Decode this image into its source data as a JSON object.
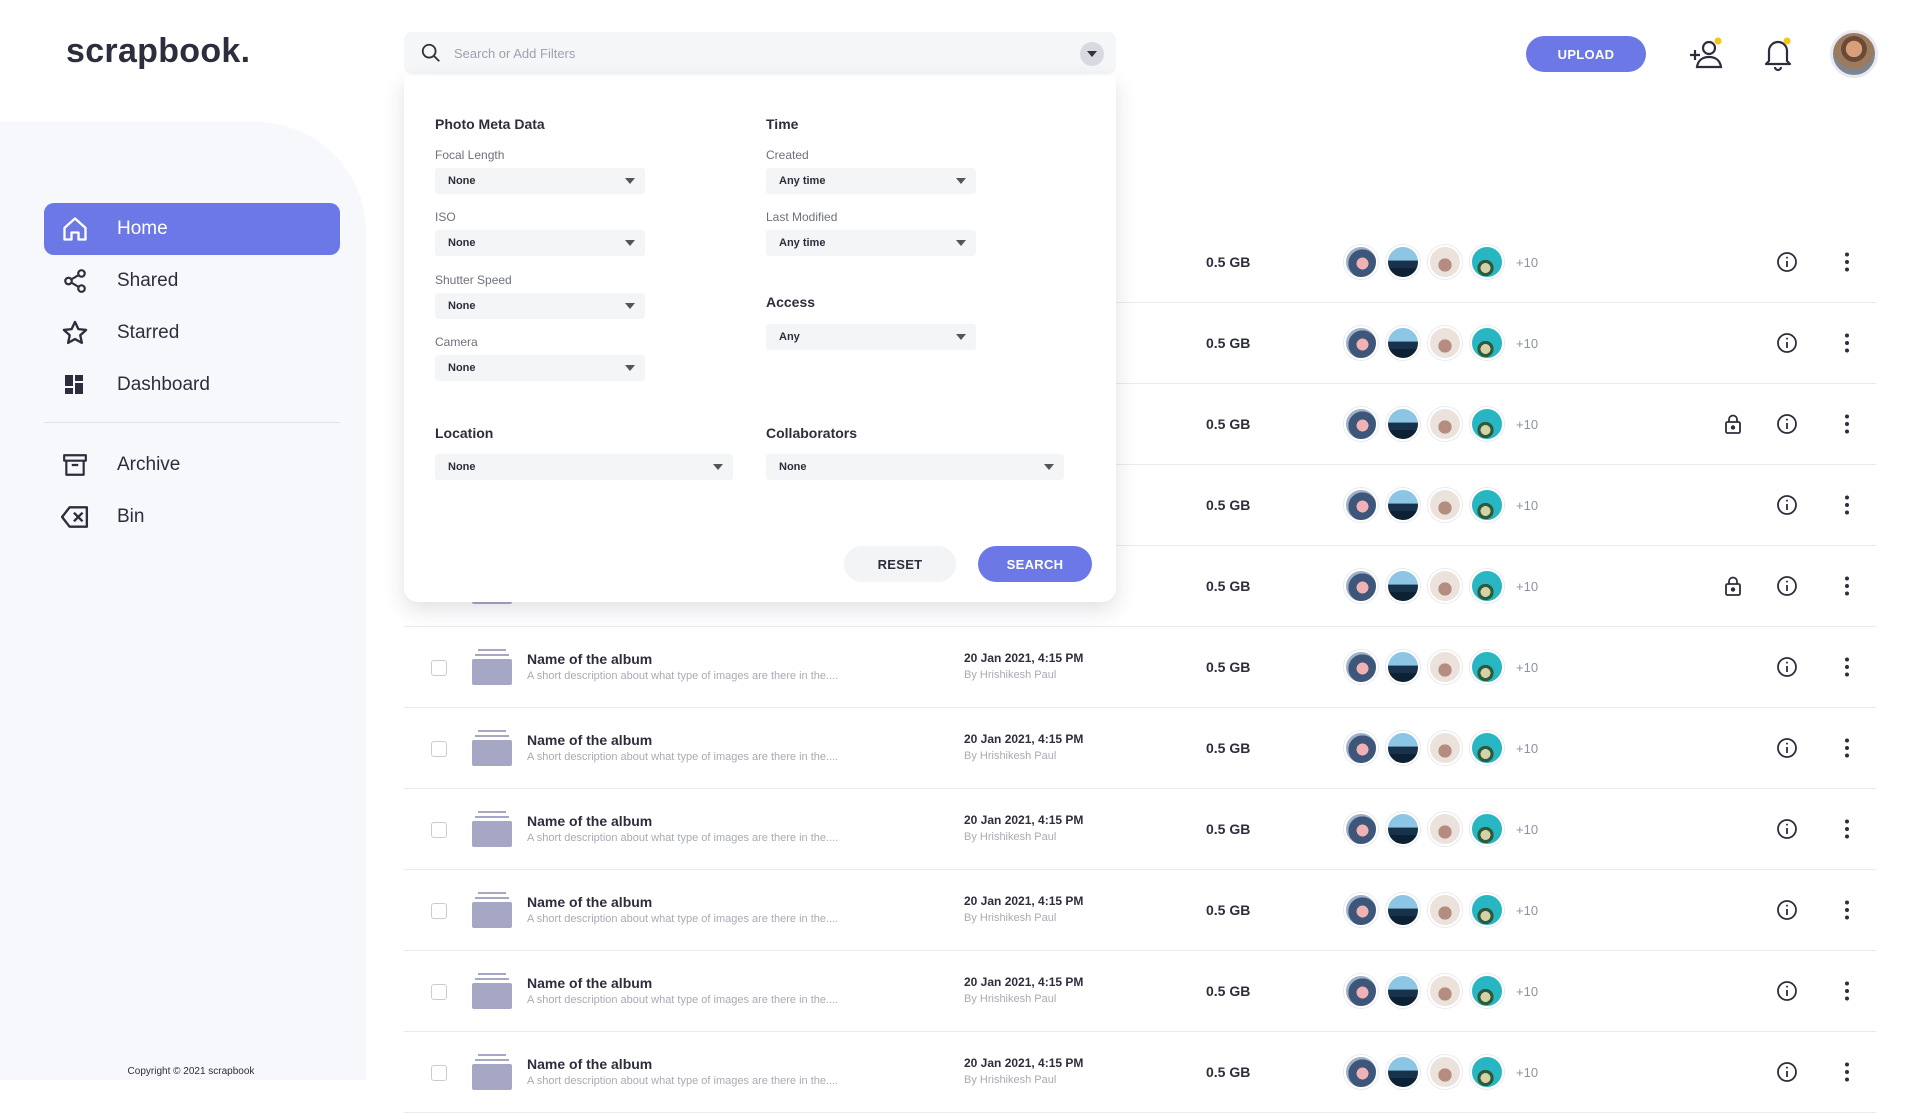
{
  "app": {
    "logo": "scrapbook.",
    "copyright": "Copyright © 2021 scrapbook"
  },
  "sidebar": {
    "items": [
      {
        "label": "Home",
        "icon": "home-icon",
        "active": true
      },
      {
        "label": "Shared",
        "icon": "share-icon"
      },
      {
        "label": "Starred",
        "icon": "star-icon"
      },
      {
        "label": "Dashboard",
        "icon": "dashboard-icon"
      },
      {
        "label": "Archive",
        "icon": "archive-icon"
      },
      {
        "label": "Bin",
        "icon": "bin-icon"
      }
    ]
  },
  "search": {
    "placeholder": "Search or Add Filters"
  },
  "header": {
    "upload_label": "UPLOAD",
    "icons": [
      "add-user-icon",
      "bell-icon",
      "avatar"
    ],
    "accent": "#6b78e5",
    "notification_dot": "#f5c518"
  },
  "filters": {
    "photo_meta_title": "Photo Meta Data",
    "focal_length_label": "Focal Length",
    "focal_length_value": "None",
    "iso_label": "ISO",
    "iso_value": "None",
    "shutter_label": "Shutter Speed",
    "shutter_value": "None",
    "camera_label": "Camera",
    "camera_value": "None",
    "time_title": "Time",
    "created_label": "Created",
    "created_value": "Any time",
    "modified_label": "Last Modified",
    "modified_value": "Any time",
    "access_title": "Access",
    "access_value": "Any",
    "location_title": "Location",
    "location_value": "None",
    "collaborators_title": "Collaborators",
    "collaborators_value": "None",
    "reset_label": "RESET",
    "search_label": "SEARCH"
  },
  "rows": [
    {
      "name": "",
      "desc": "",
      "date": "",
      "by": "",
      "size": "0.5 GB",
      "more": "+10",
      "locked": false
    },
    {
      "name": "",
      "desc": "",
      "date": "",
      "by": "",
      "size": "0.5 GB",
      "more": "+10",
      "locked": false
    },
    {
      "name": "",
      "desc": "",
      "date": "",
      "by": "",
      "size": "0.5 GB",
      "more": "+10",
      "locked": true
    },
    {
      "name": "",
      "desc": "",
      "date": "",
      "by": "",
      "size": "0.5 GB",
      "more": "+10",
      "locked": false
    },
    {
      "name": "",
      "desc": "",
      "date": "",
      "by": "",
      "size": "0.5 GB",
      "more": "+10",
      "locked": true
    },
    {
      "name": "Name of the album",
      "desc": "A short description about what type of images are there in the....",
      "date": "20 Jan 2021, 4:15 PM",
      "by": "By Hrishikesh Paul",
      "size": "0.5 GB",
      "more": "+10",
      "locked": false
    },
    {
      "name": "Name of the album",
      "desc": "A short description about what type of images are there in the....",
      "date": "20 Jan 2021, 4:15 PM",
      "by": "By Hrishikesh Paul",
      "size": "0.5 GB",
      "more": "+10",
      "locked": false
    },
    {
      "name": "Name of the album",
      "desc": "A short description about what type of images are there in the....",
      "date": "20 Jan 2021, 4:15 PM",
      "by": "By Hrishikesh Paul",
      "size": "0.5 GB",
      "more": "+10",
      "locked": false
    },
    {
      "name": "Name of the album",
      "desc": "A short description about what type of images are there in the....",
      "date": "20 Jan 2021, 4:15 PM",
      "by": "By Hrishikesh Paul",
      "size": "0.5 GB",
      "more": "+10",
      "locked": false
    },
    {
      "name": "Name of the album",
      "desc": "A short description about what type of images are there in the....",
      "date": "20 Jan 2021, 4:15 PM",
      "by": "By Hrishikesh Paul",
      "size": "0.5 GB",
      "more": "+10",
      "locked": false
    },
    {
      "name": "Name of the album",
      "desc": "A short description about what type of images are there in the....",
      "date": "20 Jan 2021, 4:15 PM",
      "by": "By Hrishikesh Paul",
      "size": "0.5 GB",
      "more": "+10",
      "locked": false
    }
  ]
}
